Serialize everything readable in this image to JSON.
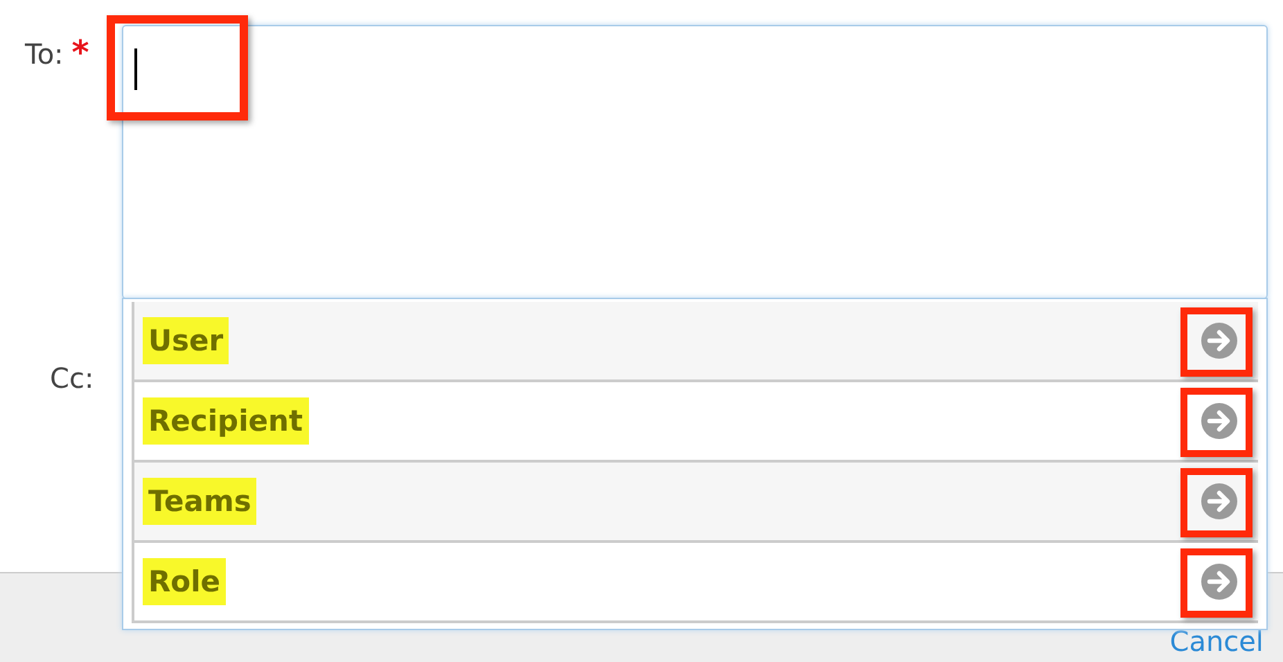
{
  "to_field": {
    "label": "To:",
    "required_mark": "*",
    "cursor_highlighted": true
  },
  "cc_field": {
    "label": "Cc:"
  },
  "dropdown": {
    "items": [
      {
        "label": "User",
        "highlighted": true
      },
      {
        "label": "Recipient",
        "highlighted": true
      },
      {
        "label": "Teams",
        "highlighted": true
      },
      {
        "label": "Role",
        "highlighted": true
      }
    ]
  },
  "footer": {
    "link": "Cancel"
  }
}
